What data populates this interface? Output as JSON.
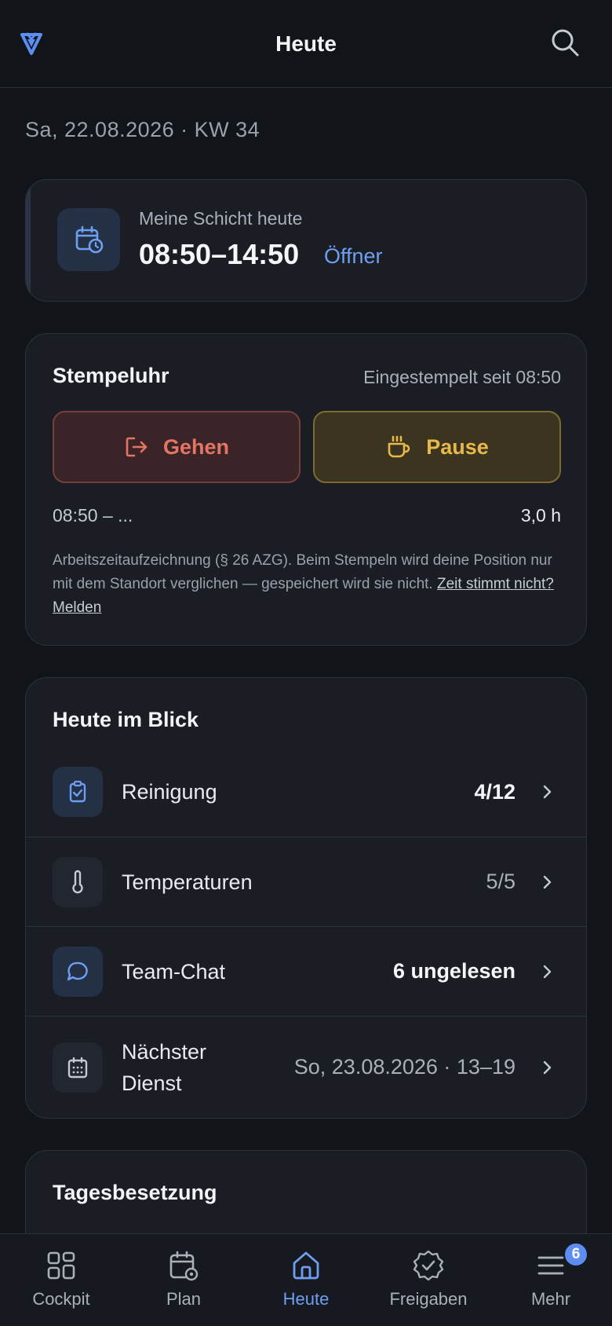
{
  "header": {
    "title": "Heute",
    "logo_icon": "brand-logo-icon",
    "search_icon": "search-icon"
  },
  "date_line": "Sa, 22.08.2026 · KW 34",
  "shift": {
    "label": "Meine Schicht heute",
    "time": "08:50–14:50",
    "role": "Öffner",
    "icon": "calendar-clock-icon"
  },
  "clock": {
    "title": "Stempeluhr",
    "status": "Eingestempelt seit 08:50",
    "go_label": "Gehen",
    "pause_label": "Pause",
    "range": "08:50 – ...",
    "hours": "3,0 h",
    "note": "Arbeitszeitaufzeichnung (§ 26 AZG). Beim Stempeln wird deine Position nur mit dem Standort verglichen — gespeichert wird sie nicht.",
    "report_link": "Zeit stimmt nicht? Melden"
  },
  "glance": {
    "title": "Heute im Blick",
    "rows": [
      {
        "label": "Reinigung",
        "value": "4/12",
        "icon": "clipboard-check-icon"
      },
      {
        "label": "Temperaturen",
        "value": "5/5",
        "icon": "thermometer-icon"
      },
      {
        "label": "Team-Chat",
        "value": "6 ungelesen",
        "icon": "chat-bubble-icon"
      },
      {
        "label_line1": "Nächster",
        "label_line2": "Dienst",
        "value": "So, 23.08.2026 · 13–19",
        "icon": "calendar-icon"
      }
    ]
  },
  "staffing": {
    "title": "Tagesbesetzung"
  },
  "tabs": [
    {
      "label": "Cockpit",
      "icon": "grid-icon"
    },
    {
      "label": "Plan",
      "icon": "calendar-settings-icon"
    },
    {
      "label": "Heute",
      "icon": "home-icon",
      "active": true
    },
    {
      "label": "Freigaben",
      "icon": "badge-check-icon"
    },
    {
      "label": "Mehr",
      "icon": "menu-icon",
      "badge": "6"
    }
  ],
  "colors": {
    "accent": "#6f9ff0",
    "go": "#e47563",
    "pause": "#e9b84b",
    "background": "#111418",
    "card": "#1a1d24"
  }
}
